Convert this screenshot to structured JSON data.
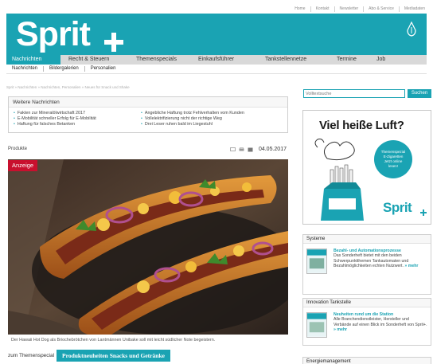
{
  "top_links": [
    "Home",
    "Kontakt",
    "Newsletter",
    "Abo & Service",
    "Mediadaten"
  ],
  "logo": {
    "text": "Sprit"
  },
  "main_nav": [
    {
      "label": "Nachrichten",
      "active": true
    },
    {
      "label": "Recht & Steuern",
      "active": false
    },
    {
      "label": "Themenspecials",
      "active": false
    },
    {
      "label": "Einkaufsführer",
      "active": false
    },
    {
      "label": "Tankstellennetze",
      "active": false
    },
    {
      "label": "Termine",
      "active": false
    },
    {
      "label": "Job",
      "active": false
    }
  ],
  "sub_nav": [
    "Nachrichten",
    "Bildergalerien",
    "Personalien"
  ],
  "breadcrumb": "Sprit » Nachrichten » Nachrichten, Personalien » Neues für Snack und Shake",
  "weitere_nachrichten": {
    "title": "Weitere Nachrichten",
    "col1": [
      "Fakten zur Mineralölwirtschaft 2017",
      "E-Mobilität schneller Erfolg für E-Mobilität",
      "Haftung für falsches Betanken"
    ],
    "col2": [
      "Angebliche Haftung trotz Fehlverhalten vom Kunden",
      "Vollelektrifizierung nicht der richtige Weg",
      "Drei Leser ruhen bald im Liegestuhl"
    ]
  },
  "article": {
    "category": "Produkte",
    "date": "04.05.2017",
    "badge": "Anzeige",
    "caption": "Der Hawaii Hot Dog als Briochebrötchen von Lantmännen Unibake soll mit leicht südlicher Note begeistern.",
    "special_label": "zum Themenspecial",
    "special_link": "Produktneuheiten Snacks und Getränke"
  },
  "sidebar": {
    "search_placeholder": "Volltextsuche",
    "search_button": "Suchen",
    "ad": {
      "headline": "Viel heiße Luft?",
      "circle_lines": [
        "Themenspezial",
        "E-Zigaretten",
        "",
        "Jetzt online",
        "lesen!"
      ],
      "logo": "Sprit"
    },
    "boxes": [
      {
        "title": "Systeme",
        "heading": "Bezahl- und Automationsprozesse",
        "text": "Das Sonderheft bietet mit den beiden Schwerpunktthemen Tankautomaten und Bezahlmöglichkeiten echten Nutzwert.",
        "more": "» mehr"
      },
      {
        "title": "Innovation Tankstelle",
        "heading": "Neuheiten rund um die Station",
        "text": "Alle Branchendienstleister, Hersteller und Verbände auf einen Blick im Sonderheft von Sprit+.",
        "more": "» mehr"
      },
      {
        "title": "Energiemanagement"
      }
    ]
  },
  "colors": {
    "brand": "#1aa3b3",
    "badge": "#c8102e"
  }
}
